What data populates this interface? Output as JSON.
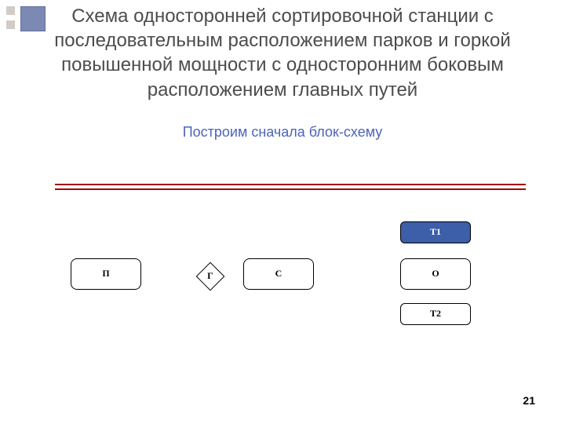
{
  "title": "Схема односторонней сортировочной станции с последовательным расположением парков и горкой повышенной мощности с односторонним боковым расположением главных путей",
  "subtitle": "Построим сначала  блок-схему",
  "blocks": {
    "p": "П",
    "g": "Г",
    "c": "С",
    "o": "О",
    "t1": "Т1",
    "t2": "Т2"
  },
  "page_number": "21",
  "colors": {
    "line": "#a20000",
    "subtitle": "#4c64b8",
    "t1_bg": "#3d5ea8"
  }
}
